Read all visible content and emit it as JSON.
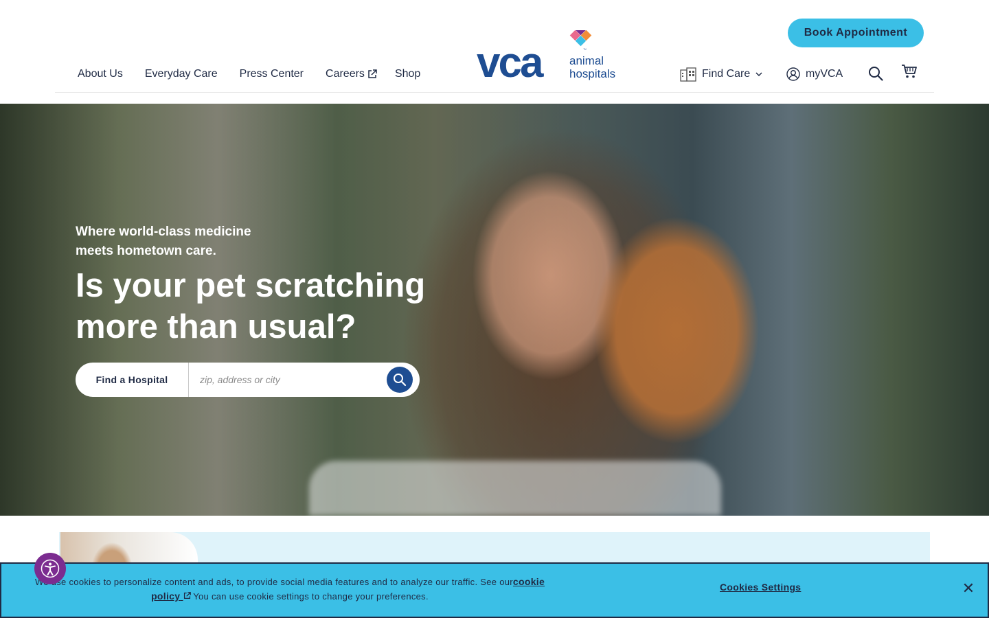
{
  "header": {
    "nav_left": [
      {
        "label": "About Us"
      },
      {
        "label": "Everyday Care"
      },
      {
        "label": "Press Center"
      },
      {
        "label": "Careers",
        "external": true
      },
      {
        "label": "Shop"
      }
    ],
    "logo": {
      "wordmark": "vca",
      "line1": "animal",
      "line2": "hospitals",
      "tm": "™"
    },
    "book_button": "Book Appointment",
    "find_care": "Find Care",
    "my_account": "myVCA",
    "icons": [
      "building-icon",
      "chevron-down-icon",
      "user-circle-icon",
      "search-icon",
      "cart-icon",
      "external-link-icon"
    ]
  },
  "hero": {
    "tagline_line1": "Where world-class medicine",
    "tagline_line2": "meets hometown care.",
    "headline_line1": "Is your pet scratching",
    "headline_line2": "more than usual?",
    "search": {
      "label": "Find a Hospital",
      "placeholder": "zip, address or city"
    }
  },
  "cookie_banner": {
    "text_before": "We use cookies to personalize content and ads, to provide social media features and to analyze our traffic. See our",
    "link_label_1": "cookie",
    "link_label_2": "policy",
    "text_after": " You can use cookie settings to change your preferences.",
    "settings_label": "Cookies Settings",
    "close_label": "✕"
  },
  "colors": {
    "brand_navy": "#1f2a44",
    "brand_blue": "#1e4d92",
    "accent_cyan": "#3bbfe6",
    "a11y_purple": "#7b2c90"
  }
}
